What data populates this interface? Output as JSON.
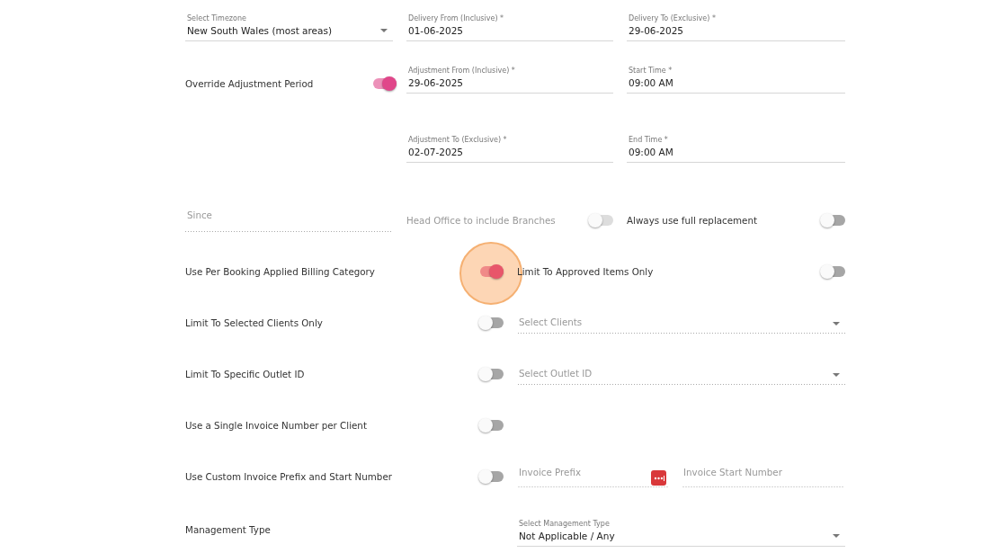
{
  "timezone": {
    "label": "Select Timezone",
    "value": "New South Wales (most areas)"
  },
  "override": {
    "label": "Override Adjustment Period",
    "on": true
  },
  "date_fields": [
    {
      "label": "Delivery From (Inclusive) *",
      "value": "01-06-2025"
    },
    {
      "label": "Delivery To (Exclusive) *",
      "value": "29-06-2025"
    },
    {
      "label": "Adjustment From (Inclusive) *",
      "value": "29-06-2025"
    },
    {
      "label": "Start Time *",
      "value": "09:00  AM"
    },
    {
      "label": "Adjustment To (Exclusive) *",
      "value": "02-07-2025"
    },
    {
      "label": "End Time *",
      "value": "09:00  AM"
    }
  ],
  "since": {
    "placeholder": "Since"
  },
  "head_office": {
    "label": "Head Office to include Branches",
    "on": false,
    "disabled": true
  },
  "full_replacement": {
    "label": "Always use full replacement",
    "on": false
  },
  "options": [
    {
      "label": "Use Per Booking Applied Billing Category",
      "on": true,
      "clicked": true,
      "right": {
        "kind": "toggle",
        "label": "Limit To Approved Items Only",
        "on": false
      }
    },
    {
      "label": "Limit To Selected Clients Only",
      "on": false,
      "right": {
        "kind": "select",
        "placeholder": "Select Clients"
      }
    },
    {
      "label": "Limit To Specific Outlet ID",
      "on": false,
      "right": {
        "kind": "select",
        "placeholder": "Select Outlet ID"
      }
    },
    {
      "label": "Use a Single Invoice Number per Client",
      "on": false
    },
    {
      "label": "Use Custom Invoice Prefix and Start Number",
      "on": false,
      "right": {
        "kind": "pair",
        "fields": [
          {
            "placeholder": "Invoice Prefix",
            "icon": true
          },
          {
            "placeholder": "Invoice Start Number"
          }
        ]
      }
    },
    {
      "label": "Management Type",
      "right": {
        "kind": "labeled_select",
        "label": "Select Management Type",
        "value": "Not Applicable / Any"
      }
    }
  ]
}
